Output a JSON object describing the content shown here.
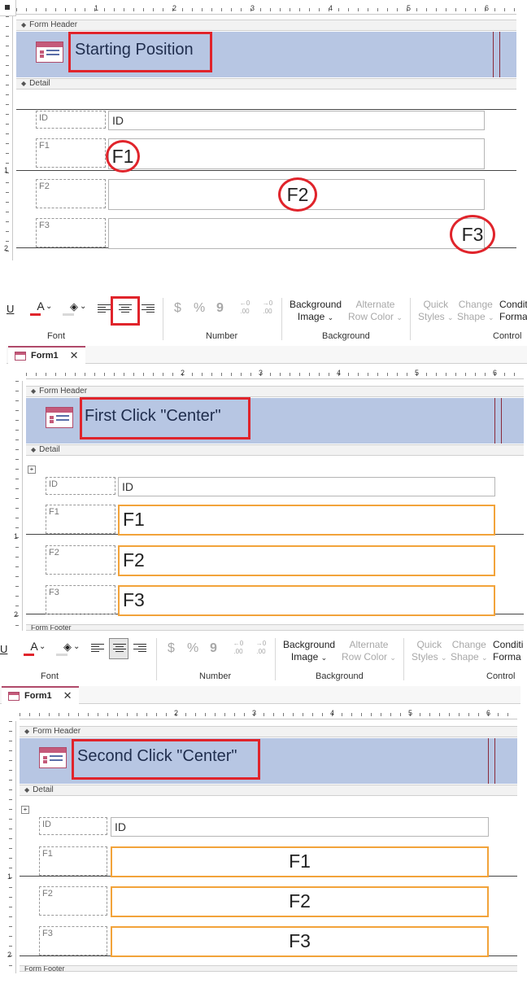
{
  "sections": {
    "form_header": "Form Header",
    "detail": "Detail",
    "form_footer": "Form Footer"
  },
  "ruler_numbers": [
    "1",
    "2",
    "3",
    "4",
    "5",
    "6"
  ],
  "vruler_numbers": [
    "1",
    "2"
  ],
  "panel1": {
    "title": "Starting Position"
  },
  "panel2": {
    "title": "First Click \"Center\""
  },
  "panel3": {
    "title": "Second Click \"Center\""
  },
  "fields": {
    "id_label": "ID",
    "id_value": "ID",
    "f1": "F1",
    "f2": "F2",
    "f3": "F3"
  },
  "ribbon": {
    "underline": "U",
    "font_color": "A",
    "groups": {
      "font": "Font",
      "number": "Number",
      "background": "Background",
      "control": "Control"
    },
    "currency": "$",
    "percent": "%",
    "comma": "9",
    "dec_inc": "←0 .00",
    "dec_dec": "→0 .00",
    "background_image_1": "Background",
    "background_image_2": "Image",
    "alternate_row_1": "Alternate",
    "alternate_row_2": "Row Color",
    "quick_styles_1": "Quick",
    "quick_styles_2": "Styles",
    "change_shape_1": "Change",
    "change_shape_2": "Shape",
    "conditional_1": "Conditi",
    "conditional_2": "Forma",
    "chevron": "⌄"
  },
  "tab": {
    "label": "Form1",
    "close": "✕"
  },
  "colors": {
    "accent_red": "#e0242b",
    "selection_orange": "#f2a33a",
    "header_blue": "#b7c6e3"
  }
}
